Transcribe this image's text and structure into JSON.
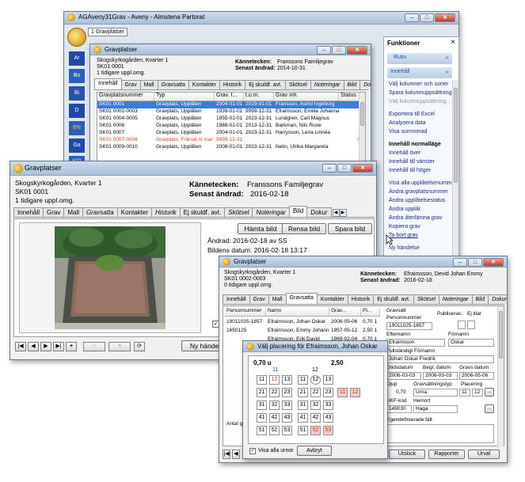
{
  "main_window": {
    "title": "AGAveny31Grav - Aveny - Almstena Partorat",
    "tab": "1 Gravplatser"
  },
  "side_toolbar": {
    "icons": [
      "logo-icon",
      "ars-icon",
      "bom-icon",
      "bil-icon",
      "detail-icon",
      "en-icon",
      "gax-icon",
      "kio-icon"
    ],
    "labels": [
      "Ar",
      "Bo",
      "Bi",
      "D",
      "EN",
      "Ga",
      "KIO"
    ]
  },
  "funktioner": {
    "title": "Funktioner",
    "close": "×",
    "section_rutin": "Rutin",
    "section_innehall": "Innehåll",
    "items": [
      "Välj kolumner och sorter",
      "Spara kolumnuppsättning",
      "Välj kolumnuppsättning...",
      "Exportera till Excel",
      "Analysera data",
      "Visa summerad",
      "Innehåll normalläge",
      "Innehåll över",
      "Innehåll till vänster",
      "Innehåll till höger",
      "Visa alla upplåtelsenummer",
      "Ändra gravplatsnummer",
      "Ändra upplåtelsestatus",
      "Ändra upplåt",
      "Ändra återlämna grav",
      "Kopiera grav",
      "Ta bort grav",
      "Ny händelse"
    ]
  },
  "win_list": {
    "title": "Gravplatser",
    "name": "Skogskyrkogården, Kvarter 1",
    "id": "SK01 0001",
    "prev": "1 tidigare uppl.omg.",
    "kanne_label": "Kännetecken:",
    "kanne_value": "Franssons Familjegrav",
    "senast_label": "Senast ändrad:",
    "senast_value": "2014-10-31",
    "tabs": [
      "Innehåll",
      "Grav",
      "Mall",
      "Gravsatta",
      "Kontakter",
      "Historik",
      "Ej skuldf. avt.",
      "Skötsel",
      "Noteringar",
      "Bild",
      "Dok"
    ],
    "headers": [
      "Gravplatsnummer",
      "Typ",
      "Grav. f...",
      "t.o.m.",
      "Grav inh.",
      "Status"
    ],
    "rows": [
      [
        "SK01 0001",
        "Gravplats, Upplåten",
        "2004-01-01",
        "2029-01-01",
        "Fransson, Astrid Ingeborg",
        ""
      ],
      [
        "SK01 0002-0003",
        "Gravplats, Upplåten",
        "1939-01-01",
        "9999-12-31",
        "Efraimsson, Emilia Johanna",
        ""
      ],
      [
        "SK01 0004-0005",
        "Gravplats, Upplåten",
        "1955-01-01",
        "2023-12-31",
        "Lundgren, Carl Magnus",
        ""
      ],
      [
        "SK01 0006",
        "Gravplats, Upplåten",
        "1988-01-01",
        "2013-12-31",
        "Barkman, Nils Rune",
        ""
      ],
      [
        "SK01 0007",
        "Gravplats, Upplåten",
        "2004-01-01",
        "2023-12-31",
        "Harrysson, Lena Linnéa",
        ""
      ],
      [
        "SK01 0007-0008",
        "Gravplats, Frånsd.ni mar",
        "9999-12-31",
        "",
        "",
        "0"
      ],
      [
        "SK01 0009-0010",
        "Gravplats, Upplåten",
        "2008-01-01",
        "2023-12-31",
        "Nelin, Ulrika Margareta",
        ""
      ]
    ]
  },
  "win_bild": {
    "title": "Gravplatser",
    "name": "Skogskyrkogården, Kvarter 1",
    "id": "SK01 0001",
    "prev": "1 tidigare uppl.omg.",
    "kanne_label": "Kännetecken:",
    "kanne_value": "Franssons Familjegrav",
    "senast_label": "Senast ändrad:",
    "senast_value": "2016-02-18",
    "tabs": [
      "Innehåll",
      "Grav",
      "Mall",
      "Gravsatta",
      "Kontakter",
      "Historik",
      "Ej skuldf. avt.",
      "Skötsel",
      "Noteringar",
      "Bild",
      "Dokur"
    ],
    "btn_hamta": "Hämta bild",
    "btn_rensa": "Rensa bild",
    "btn_spara": "Spara bild",
    "andrad": "Ändrad: 2016-02-18 av SS",
    "bildens_datum": "Bildens datum: 2016-02-18 13:17",
    "nav": [
      "⏮",
      "◀",
      "▶",
      "⏭",
      "+",
      "✓",
      "✕",
      "⟳"
    ],
    "ny_handelse": "Ny händel"
  },
  "win_gravsatta": {
    "title": "Gravplatser",
    "name": "Skogskyrkogården, Kvarter 1",
    "id": "SK01 0002-0003",
    "prev": "0 tidigare uppl.omg.",
    "kanne_label": "Kännetecken:",
    "kanne_value": "Efraimsson, Devid Johan Emmy",
    "senast_label": "Senast ändrad:",
    "senast_value": "2016-02-18",
    "tabs": [
      "Innehåll",
      "Grav",
      "Mall",
      "Gravsatta",
      "Kontakter",
      "Historik",
      "Ej skuldf. avt.",
      "Skötsel",
      "Noteringar",
      "Bild",
      "Dokur"
    ],
    "headers": [
      "Personnummer",
      "Namn",
      "Grav...",
      "Pl.."
    ],
    "rows": [
      [
        "19011025-1857",
        "Efraimsson, Johan Oskar",
        "2006-05-06",
        "0,70 1"
      ],
      [
        "1650125",
        "Efraimsson, Emmy Johanna",
        "1957-05-12",
        "2,50 1"
      ],
      [
        "",
        "Efraimsson, Erik David",
        "1969-02-04",
        "0,70 1"
      ]
    ],
    "form": {
      "gravsatt": "Gravsatt",
      "personnummer_lbl": "Personnummer",
      "personnummer": "19011025-1857",
      "publiceras_lbl": "Publiceras:",
      "publiceras": "Ej klar",
      "efternamn_lbl": "Efternamn",
      "efternamn": "Efraimsson",
      "fornamn_lbl": "Förnamn",
      "fornamn": "Oskar",
      "fullstandigt_lbl": "Fullständigt Förnamn",
      "fullstandigt": "Johan Oskar Fredrik",
      "dodsdatum_lbl": "Dödsdatum",
      "dodsdatum": "2006-03-03",
      "begr_lbl": "Begr. datum",
      "begr": "2006-03-03",
      "gravs_lbl": "Gravs datum",
      "gravs": "2006-05-06",
      "djup_lbl": "Djup",
      "djup": "0,70",
      "gravsattning_lbl": "Gravsättningstyp",
      "gravsattning": "Urna",
      "placering_lbl": "Placering",
      "placering": "11",
      "placering2": "12",
      "ukf_lbl": "UKF-kod",
      "ukf": "149030",
      "hemort_lbl": "Hemort",
      "hemort": "Haga",
      "egendef_lbl": "Egendefinierade fält",
      "antal_lbl": "Antal g"
    },
    "btn_utskick": "Utskick",
    "btn_rapporter": "Rapporter",
    "btn_urval": "Urval"
  },
  "placement_dialog": {
    "title": "Välj placering för Efraimsson, Johan Oskar",
    "area1_label": "0,70 u",
    "area1_col": "11",
    "area1_rows": [
      [
        "11",
        "12",
        "13",
        "",
        "11",
        "12",
        "13"
      ],
      [
        "21",
        "22",
        "23",
        "",
        "21",
        "22",
        "23"
      ],
      [
        "31",
        "32",
        "33",
        "",
        "31",
        "32",
        "33"
      ],
      [
        "41",
        "42",
        "43",
        "",
        "41",
        "42",
        "43"
      ],
      [
        "51",
        "52",
        "53",
        "",
        "51",
        "52",
        "53"
      ]
    ],
    "area1_col2": "12",
    "area2_label": "2,50",
    "area2_cells": [
      "11",
      "12"
    ],
    "visa_alla": "Visa alla urnor",
    "avbryt": "Avbryt"
  }
}
